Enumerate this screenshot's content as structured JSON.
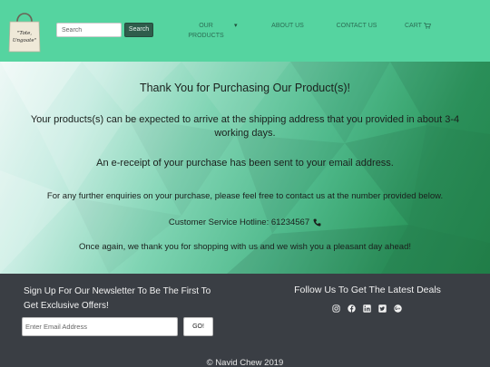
{
  "header": {
    "logo_text": "\"Tote, Ungoate\"",
    "search": {
      "placeholder": "Search",
      "button_label": "Search"
    },
    "nav": {
      "products_label": "OUR PRODUCTS",
      "about_label": "ABOUT US",
      "contact_label": "CONTACT US",
      "cart_label": "CART"
    },
    "colors": {
      "header_bg": "#55d4a0",
      "nav_text": "#2b6e54",
      "search_button_bg": "#2f5d4c"
    }
  },
  "main": {
    "title": "Thank You for Purchasing Our Product(s)!",
    "delivery_text": "Your products(s) can be expected to arrive at the shipping address that you provided in about 3-4 working days.",
    "receipt_text": "An e-receipt of your purchase has been sent to your email address.",
    "enquiry_text": "For any further enquiries on your purchase, please feel free to contact us at the number provided below.",
    "hotline_text": "Customer Service Hotline: 61234567",
    "closing_text": "Once again, we thank you for shopping with us and we wish you a pleasant day ahead!",
    "icons": {
      "hotline": "phone-icon"
    }
  },
  "footer": {
    "newsletter_heading": "Sign Up For Our Newsletter To Be The First To Get Exclusive Offers!",
    "email_placeholder": "Enter Email Address",
    "go_label": "GO!",
    "follow_heading": "Follow Us To Get The Latest Deals",
    "social_icons": [
      "instagram-icon",
      "facebook-icon",
      "linkedin-icon",
      "twitter-icon",
      "google-plus-icon"
    ],
    "copyright": "© Navid Chew 2019",
    "colors": {
      "footer_bg": "#3a3e44",
      "footer_text": "#f2f2f2"
    }
  }
}
